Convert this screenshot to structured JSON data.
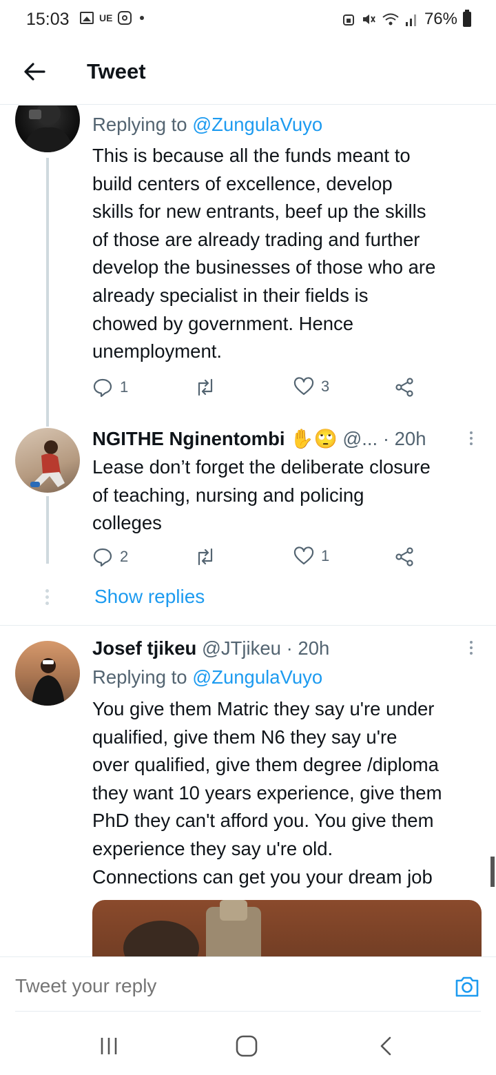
{
  "status_bar": {
    "time": "15:03",
    "carrier_label": "UE",
    "battery": "76%",
    "icons": [
      "gallery-icon",
      "instagram-icon",
      "dot-icon",
      "alarm-icon",
      "mute-icon",
      "wifi-icon",
      "signal-icon",
      "battery-icon"
    ]
  },
  "header": {
    "title": "Tweet",
    "back_icon": "arrow-left-icon"
  },
  "tweets": [
    {
      "replying_prefix": "Replying to",
      "replying_handle": "@ZungulaVuyo",
      "text_lines": [
        "This is because all the funds meant to",
        "build centers of excellence, develop",
        "skills for new entrants, beef up the skills",
        "of those are already trading and further",
        "develop the businesses of those who are",
        "already specialist in their fields is",
        "chowed by government. Hence",
        "unemployment."
      ],
      "replies": "1",
      "retweets": "",
      "likes": "3"
    },
    {
      "name": "NGITHE Nginentombi",
      "emojis": "✋🙄",
      "handle": "@...",
      "time": "· 20h",
      "text_lines": [
        "Lease don’t forget the deliberate closure",
        "of teaching, nursing and policing",
        "colleges"
      ],
      "replies": "2",
      "retweets": "",
      "likes": "1"
    },
    {
      "name": "Josef tjikeu",
      "handle": "@JTjikeu",
      "time": "· 20h",
      "replying_prefix": "Replying to",
      "replying_handle": "@ZungulaVuyo",
      "text_lines": [
        "You give them Matric they say u're under",
        "qualified, give them N6 they say u're",
        "over qualified, give them degree /diploma",
        "they want 10 years experience, give them",
        "PhD they can't afford you. You give them",
        "experience they say u're old.",
        "Connections can get you your dream job"
      ]
    }
  ],
  "show_replies": "Show replies",
  "composer": {
    "placeholder": "Tweet your reply"
  },
  "nav": {
    "icons": [
      "recent-apps-icon",
      "home-icon",
      "back-icon"
    ]
  }
}
